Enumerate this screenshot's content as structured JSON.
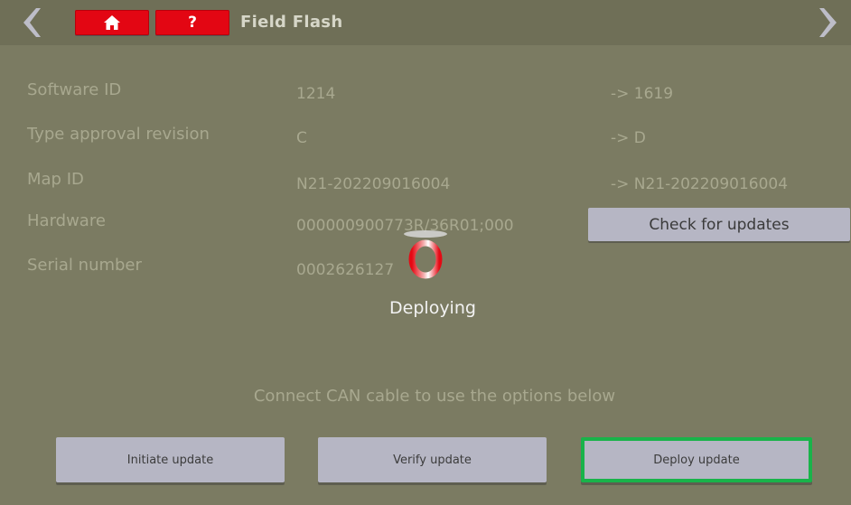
{
  "header": {
    "title": "Field Flash",
    "home_icon": "home-icon",
    "help_label": "?",
    "back_icon": "chevron-left-icon",
    "forward_icon": "chevron-right-icon",
    "accent_color": "#e30613"
  },
  "rows": [
    {
      "label": "Software ID",
      "current": "1214",
      "new": "-> 1619"
    },
    {
      "label": "Type approval revision",
      "current": "C",
      "new": "-> D"
    },
    {
      "label": "Map ID",
      "current": "N21-202209016004",
      "new": "-> N21-202209016004"
    },
    {
      "label": "Hardware",
      "current": "000000900773R/36R01;000"
    },
    {
      "label": "Serial number",
      "current": "0002626127"
    }
  ],
  "check_button": "Check for updates",
  "status": {
    "spinner_icon": "loading-spinner-icon",
    "text": "Deploying"
  },
  "connect_message": "Connect CAN cable to use the options below",
  "buttons": {
    "initiate": "Initiate update",
    "verify": "Verify update",
    "deploy": "Deploy update",
    "highlight_color": "#19b34a"
  }
}
